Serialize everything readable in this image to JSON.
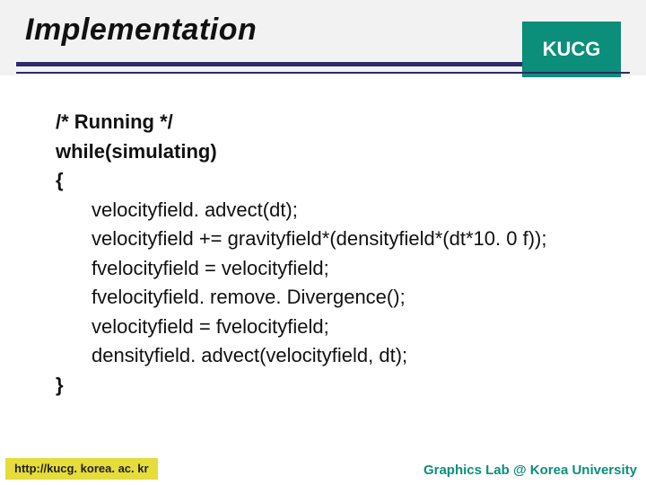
{
  "header": {
    "title": "Implementation",
    "badge": "KUCG"
  },
  "code": {
    "l1": "/*  Running */",
    "l2": "while(simulating)",
    "l3": "{",
    "l4": "velocityfield. advect(dt);",
    "l5": "velocityfield += gravityfield*(densityfield*(dt*10. 0 f));",
    "l6": "fvelocityfield = velocityfield;",
    "l7": "fvelocityfield. remove. Divergence();",
    "l8": "velocityfield = fvelocityfield;",
    "l9": "densityfield. advect(velocityfield, dt);",
    "l10": "}"
  },
  "footer": {
    "left": "http://kucg. korea. ac. kr",
    "right": "Graphics Lab @ Korea University"
  }
}
